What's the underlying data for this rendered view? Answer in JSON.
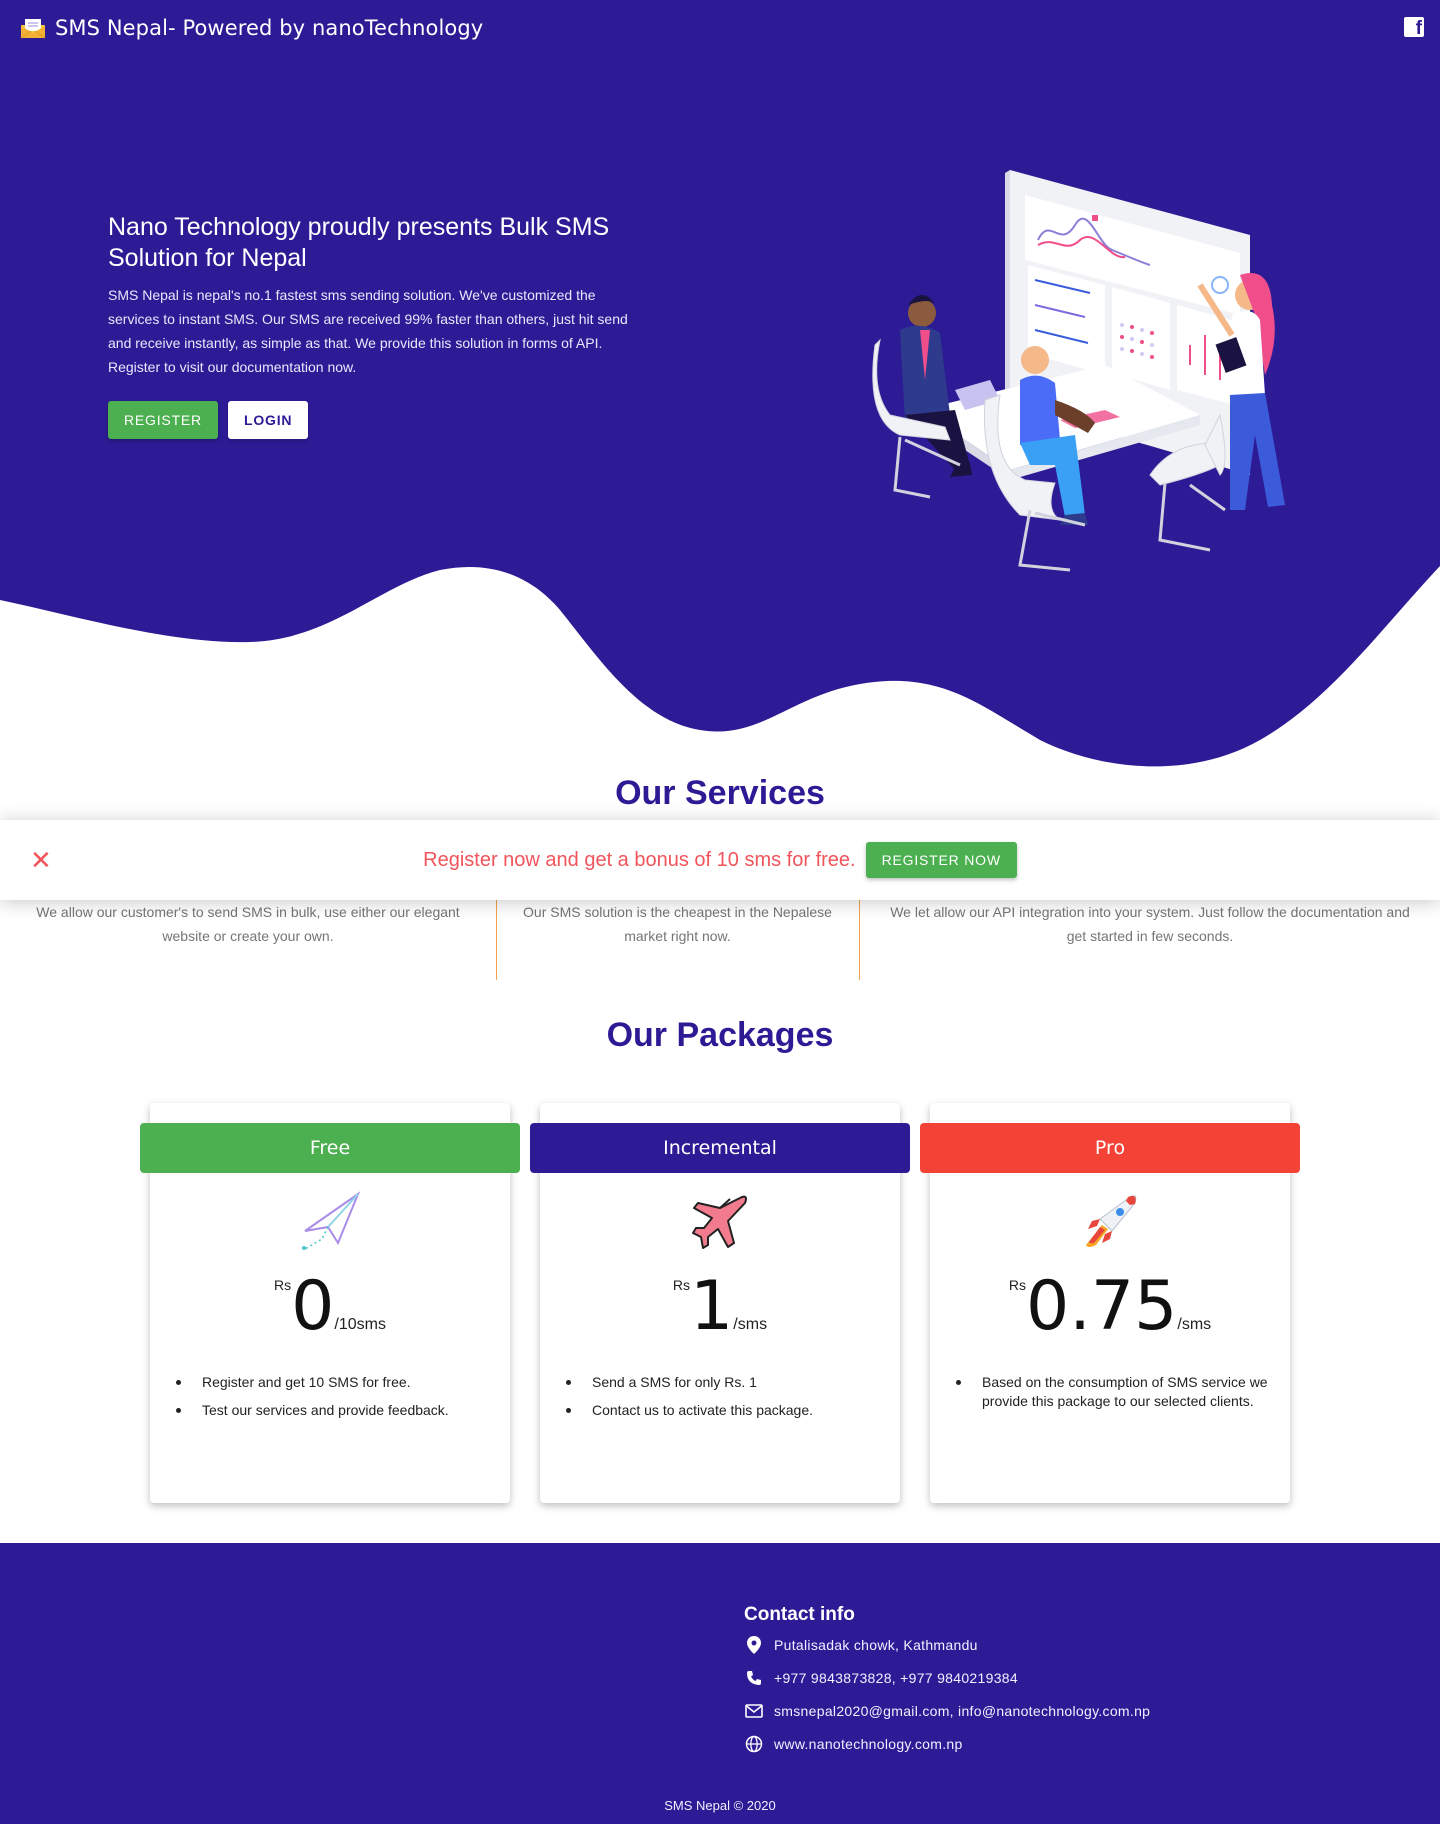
{
  "header": {
    "brand": "SMS Nepal- Powered by nanoTechnology",
    "facebook_icon": "facebook-icon"
  },
  "hero": {
    "title": "Nano Technology proudly presents Bulk SMS Solution for Nepal",
    "description": "SMS Nepal is nepal's no.1 fastest sms sending solution. We've customized the services to instant SMS. Our SMS are received 99% faster than others, just hit send and receive instantly, as simple as that. We provide this solution in forms of API. Register to visit our documentation now.",
    "register_label": "REGISTER",
    "login_label": "LOGIN"
  },
  "services": {
    "title": "Our Services",
    "items": [
      {
        "text": "We allow our customer's to send SMS in bulk, use either our elegant website or create your own."
      },
      {
        "text": "Our SMS solution is the cheapest in the Nepalese market right now."
      },
      {
        "text": "We let allow our API integration into your system. Just follow the documentation and get started in few seconds."
      }
    ]
  },
  "banner": {
    "close_icon": "close-icon",
    "text": "Register now and get a bonus of 10 sms for free.",
    "button_label": "REGISTER NOW"
  },
  "packages": {
    "title": "Our Packages",
    "items": [
      {
        "name": "Free",
        "icon": "paper-plane-icon",
        "currency": "Rs",
        "price": "0",
        "unit": "/10sms",
        "features": [
          "Register and get 10 SMS for free.",
          "Test our services and provide feedback."
        ]
      },
      {
        "name": "Incremental",
        "icon": "airplane-icon",
        "currency": "Rs",
        "price": "1",
        "unit": "/sms",
        "features": [
          "Send a SMS for only Rs. 1",
          "Contact us to activate this package."
        ]
      },
      {
        "name": "Pro",
        "icon": "rocket-icon",
        "currency": "Rs",
        "price": "0.75",
        "unit": "/sms",
        "features": [
          "Based on the consumption of SMS service we provide this package to our selected clients."
        ]
      }
    ]
  },
  "footer": {
    "contact_title": "Contact info",
    "address": "Putalisadak chowk, Kathmandu",
    "phone": "+977 9843873828, +977 9840219384",
    "email": "smsnepal2020@gmail.com, info@nanotechnology.com.np",
    "website": "www.nanotechnology.com.np",
    "copyright": "SMS Nepal © 2020"
  },
  "colors": {
    "brand": "#2d1b96",
    "green": "#4caf50",
    "red": "#f44336",
    "accent_text": "#f2545b",
    "divider": "#f0a24a"
  }
}
